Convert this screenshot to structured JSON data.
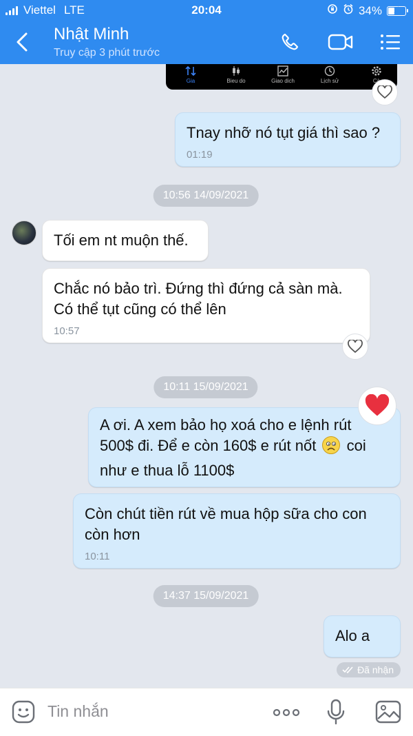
{
  "status_bar": {
    "carrier": "Viettel",
    "network": "LTE",
    "time": "20:04",
    "battery": "34%",
    "battery_level": 0.34
  },
  "header": {
    "contact_name": "Nhật Minh",
    "presence": "Truy cập 3 phút trước"
  },
  "embedded_screenshot": {
    "tabs": [
      "Gia",
      "Bieu do",
      "Giao dich",
      "Lịch sử",
      "Cà"
    ]
  },
  "chat": {
    "m1_text": "Tnay nhỡ nó tụt giá thì sao ?",
    "m1_time": "01:19",
    "date1": "10:56 14/09/2021",
    "m2_text": "Tối em nt muộn thế.",
    "m3_line1": "Chắc nó bảo trì. Đứng thì đứng cả sàn mà.",
    "m3_line2": "Có thể tụt cũng có thể lên",
    "m3_time": "10:57",
    "date2": "10:11 15/09/2021",
    "m4_line1": "A ơi. A xem bảo họ xoá cho e lệnh rút",
    "m4_line2a": "500$ đi. Để e còn 160$ e rút nốt",
    "m4_line2b": "coi",
    "m4_line3": "như e thua lỗ 1100$",
    "m5_line1": "Còn chút tiền rút về mua hộp sữa cho con",
    "m5_line2": "còn hơn",
    "m5_time": "10:11",
    "date3": "14:37 15/09/2021",
    "m6_text": "Alo a",
    "receipt": "Đã nhận"
  },
  "composer": {
    "placeholder": "Tin nhắn"
  },
  "colors": {
    "header_bg": "#2f8bf0",
    "chat_bg": "#e3e7ee",
    "my_bubble": "#d5ebfc",
    "their_bubble": "#ffffff",
    "heart": "#e8303f"
  }
}
